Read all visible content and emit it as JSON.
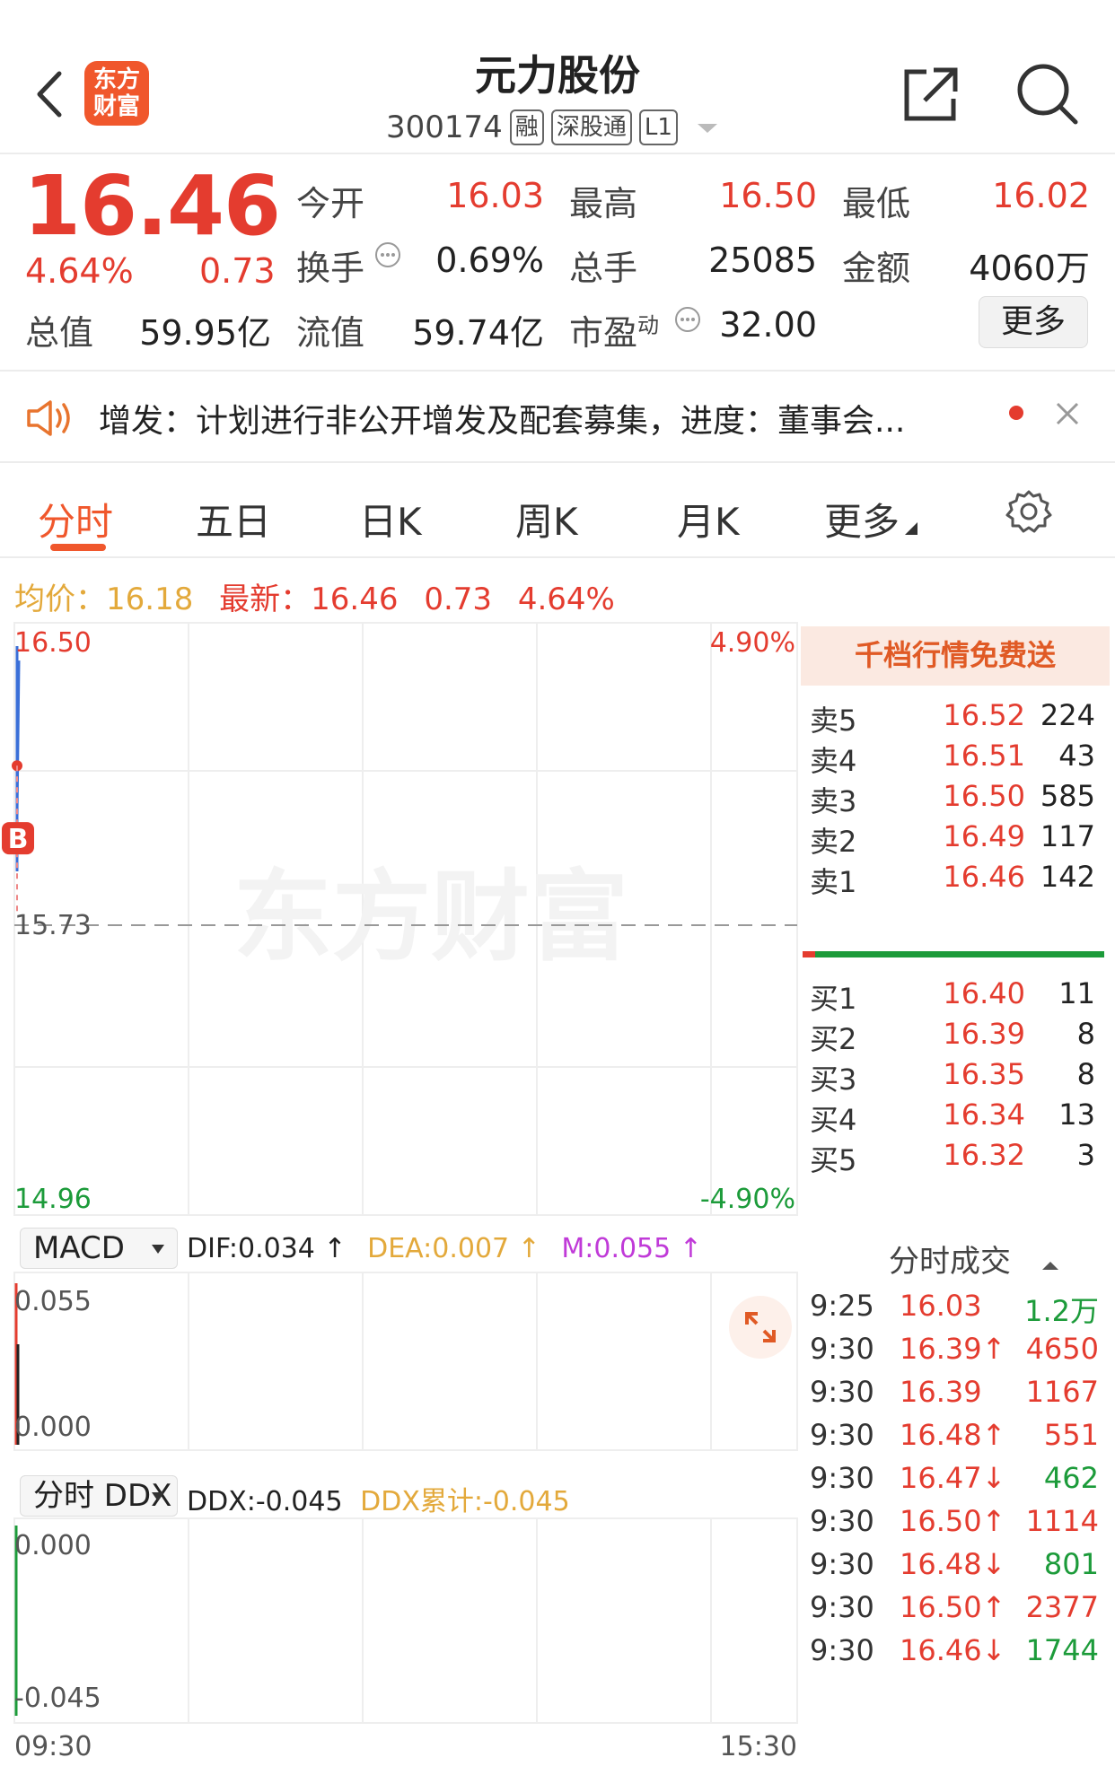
{
  "header": {
    "title": "元力股份",
    "code": "300174",
    "tags": [
      "融",
      "深股通",
      "L1"
    ],
    "logo_text": [
      "东方",
      "财富"
    ]
  },
  "quote": {
    "price": "16.46",
    "change_pct": "4.64%",
    "change": "0.73",
    "items": [
      {
        "label": "今开",
        "value": "16.03",
        "color": "red"
      },
      {
        "label": "最高",
        "value": "16.50",
        "color": "red"
      },
      {
        "label": "最低",
        "value": "16.02",
        "color": "red"
      },
      {
        "label": "换手",
        "value": "0.69%",
        "color": "black"
      },
      {
        "label": "总手",
        "value": "25085",
        "color": "black"
      },
      {
        "label": "金额",
        "value": "4060万",
        "color": "black"
      },
      {
        "label": "总值",
        "value": "59.95亿",
        "color": "black"
      },
      {
        "label": "流值",
        "value": "59.74亿",
        "color": "black"
      },
      {
        "label": "市盈",
        "label_sup": "动",
        "value": "32.00",
        "color": "black"
      }
    ],
    "more_label": "更多"
  },
  "notice": {
    "text": "增发：计划进行非公开增发及配套募集，进度：董事会..."
  },
  "tabs": [
    "分时",
    "五日",
    "日K",
    "周K",
    "月K",
    "更多"
  ],
  "active_tab": "分时",
  "infoline": {
    "avg_label": "均价：",
    "avg_value": "16.18",
    "latest_label": "最新：",
    "latest_value": "16.46",
    "latest_change": "0.73",
    "latest_pct": "4.64%"
  },
  "chart_data": [
    {
      "type": "line",
      "y_left_labels": [
        "16.50",
        "15.73",
        "14.96"
      ],
      "y_right_labels": [
        "4.90%",
        "-4.90%"
      ],
      "x_labels": [
        "09:30",
        "15:30"
      ],
      "ylim": [
        14.96,
        16.5
      ],
      "reference_line": 15.73,
      "series": [
        {
          "x": [
            "09:25",
            "09:30"
          ],
          "y": [
            16.03,
            16.46
          ]
        }
      ],
      "markers": [
        {
          "label": "B",
          "y": 15.97
        }
      ],
      "watermark": "东方财富"
    },
    {
      "type": "line",
      "indicator": "MACD",
      "y_labels": [
        "0.055",
        "0.000"
      ],
      "legend": [
        {
          "text": "DIF:0.034 ↑",
          "color": "#222222"
        },
        {
          "text": "DEA:0.007 ↑",
          "color": "#e3a93b"
        },
        {
          "text": "M:0.055 ↑",
          "color": "#c03ad8"
        }
      ]
    },
    {
      "type": "line",
      "indicator": "分时 DDX",
      "y_labels": [
        "0.000",
        "-0.045"
      ],
      "legend": [
        {
          "text": "DDX:-0.045",
          "color": "#222222"
        },
        {
          "text": "DDX累计:-0.045",
          "color": "#e3a93b"
        }
      ]
    }
  ],
  "orderbook": {
    "header": "千档行情免费送",
    "asks": [
      {
        "label": "卖5",
        "price": "16.52",
        "vol": "224"
      },
      {
        "label": "卖4",
        "price": "16.51",
        "vol": "43"
      },
      {
        "label": "卖3",
        "price": "16.50",
        "vol": "585"
      },
      {
        "label": "卖2",
        "price": "16.49",
        "vol": "117"
      },
      {
        "label": "卖1",
        "price": "16.46",
        "vol": "142"
      }
    ],
    "bids": [
      {
        "label": "买1",
        "price": "16.40",
        "vol": "11"
      },
      {
        "label": "买2",
        "price": "16.39",
        "vol": "8"
      },
      {
        "label": "买3",
        "price": "16.35",
        "vol": "8"
      },
      {
        "label": "买4",
        "price": "16.34",
        "vol": "13"
      },
      {
        "label": "买5",
        "price": "16.32",
        "vol": "3"
      }
    ]
  },
  "trades": {
    "header": "分时成交",
    "rows": [
      {
        "time": "9:25",
        "price": "16.03",
        "vol": "1.2万",
        "vol_color": "green"
      },
      {
        "time": "9:30",
        "price": "16.39↑",
        "vol": "4650",
        "vol_color": "red"
      },
      {
        "time": "9:30",
        "price": "16.39",
        "vol": "1167",
        "vol_color": "red"
      },
      {
        "time": "9:30",
        "price": "16.48↑",
        "vol": "551",
        "vol_color": "red"
      },
      {
        "time": "9:30",
        "price": "16.47↓",
        "vol": "462",
        "vol_color": "green"
      },
      {
        "time": "9:30",
        "price": "16.50↑",
        "vol": "1114",
        "vol_color": "red"
      },
      {
        "time": "9:30",
        "price": "16.48↓",
        "vol": "801",
        "vol_color": "green"
      },
      {
        "time": "9:30",
        "price": "16.50↑",
        "vol": "2377",
        "vol_color": "red"
      },
      {
        "time": "9:30",
        "price": "16.46↓",
        "vol": "1744",
        "vol_color": "green"
      }
    ]
  },
  "colors": {
    "up": "#e43c2f",
    "down": "#1c9b3a",
    "accent": "#f0572c",
    "avg_line": "#e3a93b",
    "macd_m": "#c03ad8"
  },
  "icons": [
    "back-arrow-icon",
    "share-icon",
    "search-icon",
    "speaker-icon",
    "close-icon",
    "gear-icon",
    "expand-icon",
    "dropdown-triangle-icon"
  ]
}
